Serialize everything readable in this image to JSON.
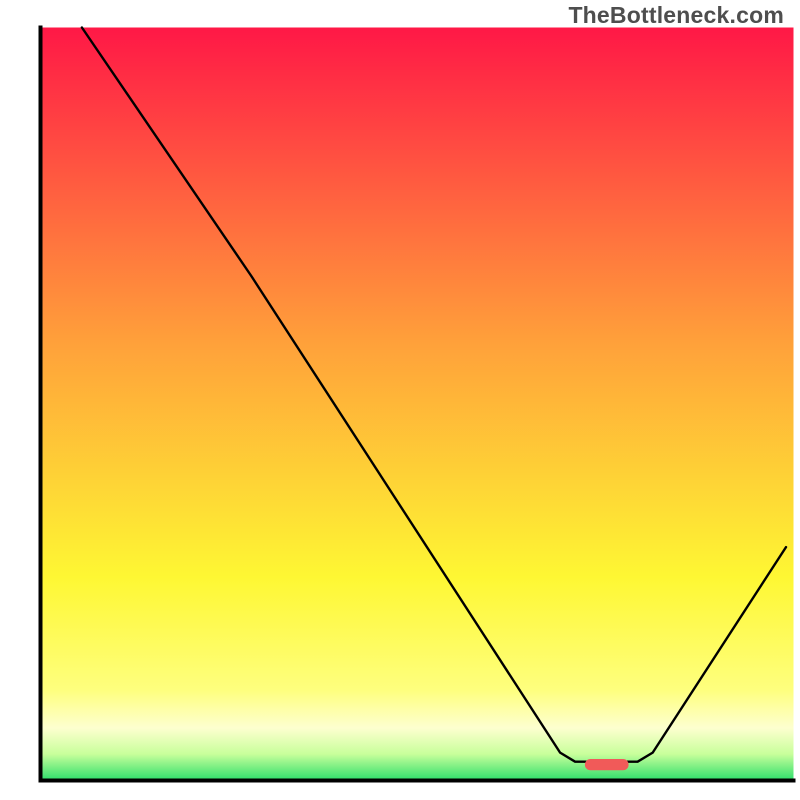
{
  "watermark": "TheBottleneck.com",
  "chart_data": {
    "type": "line",
    "title": "",
    "xlabel": "",
    "ylabel": "",
    "xlim": [
      0,
      100
    ],
    "ylim": [
      0,
      100
    ],
    "grid": false,
    "legend": false,
    "background_gradient_stops": [
      {
        "offset": 0.0,
        "color": "#ff1846"
      },
      {
        "offset": 0.42,
        "color": "#ffa13a"
      },
      {
        "offset": 0.73,
        "color": "#fef733"
      },
      {
        "offset": 0.88,
        "color": "#feff7e"
      },
      {
        "offset": 0.93,
        "color": "#fdffcf"
      },
      {
        "offset": 0.965,
        "color": "#c8ff9b"
      },
      {
        "offset": 1.0,
        "color": "#2cde6b"
      }
    ],
    "curve": [
      {
        "x": 5.5,
        "y": 100.0
      },
      {
        "x": 22.5,
        "y": 75.0,
        "control": true
      },
      {
        "x": 28.0,
        "y": 67.0
      },
      {
        "x": 69.0,
        "y": 3.7
      },
      {
        "x": 71.0,
        "y": 2.5
      },
      {
        "x": 79.3,
        "y": 2.5
      },
      {
        "x": 81.3,
        "y": 3.7
      },
      {
        "x": 99.0,
        "y": 31.0
      }
    ],
    "marker": {
      "shape": "pill",
      "x_center": 75.2,
      "y": 2.1,
      "width": 5.8,
      "height": 1.5,
      "color": "#f15a59"
    },
    "notes": "x and y are in percent of the plot-area coordinate system (origin at bottom-left). Curve values are read approximately from the image; 'control' marks an intermediate slope-change point near the upper-left. The marker is a rounded red bar sitting just above the x-axis inside the curve valley."
  }
}
